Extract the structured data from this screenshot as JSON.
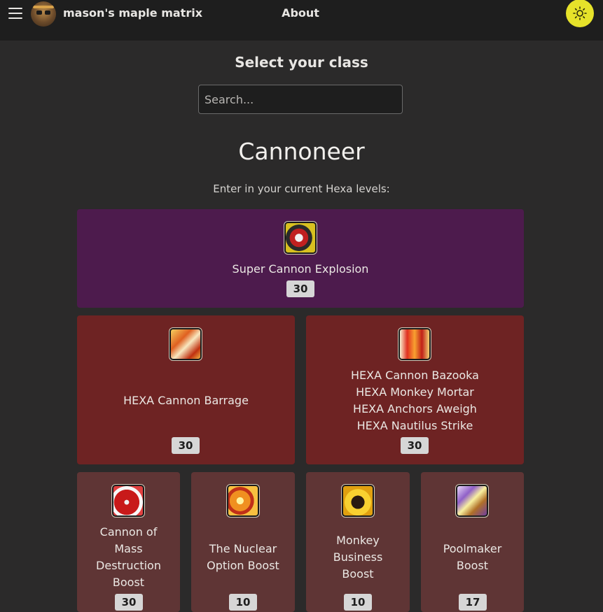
{
  "nav": {
    "brand": "mason's maple matrix",
    "about": "About",
    "menu_icon": "hamburger-menu-icon",
    "theme_icon": "sun-icon",
    "theme_color": "#e6e22a"
  },
  "class_select": {
    "title": "Select your class",
    "search_placeholder": "Search..."
  },
  "class": {
    "name": "Cannoneer",
    "instructions": "Enter in your current Hexa levels:"
  },
  "skills": {
    "origin": {
      "name": "Super Cannon Explosion",
      "level": "30",
      "color": "#4d1b4d"
    },
    "mastery": [
      {
        "lines": [
          "HEXA Cannon Barrage"
        ],
        "level": "30",
        "color": "#6e2323"
      },
      {
        "lines": [
          "HEXA Cannon Bazooka",
          "HEXA Monkey Mortar",
          "HEXA Anchors Aweigh",
          "HEXA Nautilus Strike"
        ],
        "level": "30",
        "color": "#6e2323"
      }
    ],
    "boosts": [
      {
        "lines": [
          "Cannon of",
          "Mass",
          "Destruction",
          "Boost"
        ],
        "level": "30",
        "color": "#5f3535"
      },
      {
        "lines": [
          "The Nuclear",
          "Option Boost"
        ],
        "level": "10",
        "color": "#5f3535"
      },
      {
        "lines": [
          "Monkey",
          "Business",
          "Boost"
        ],
        "level": "10",
        "color": "#5f3535"
      },
      {
        "lines": [
          "Poolmaker",
          "Boost"
        ],
        "level": "17",
        "color": "#5f3535"
      }
    ]
  }
}
